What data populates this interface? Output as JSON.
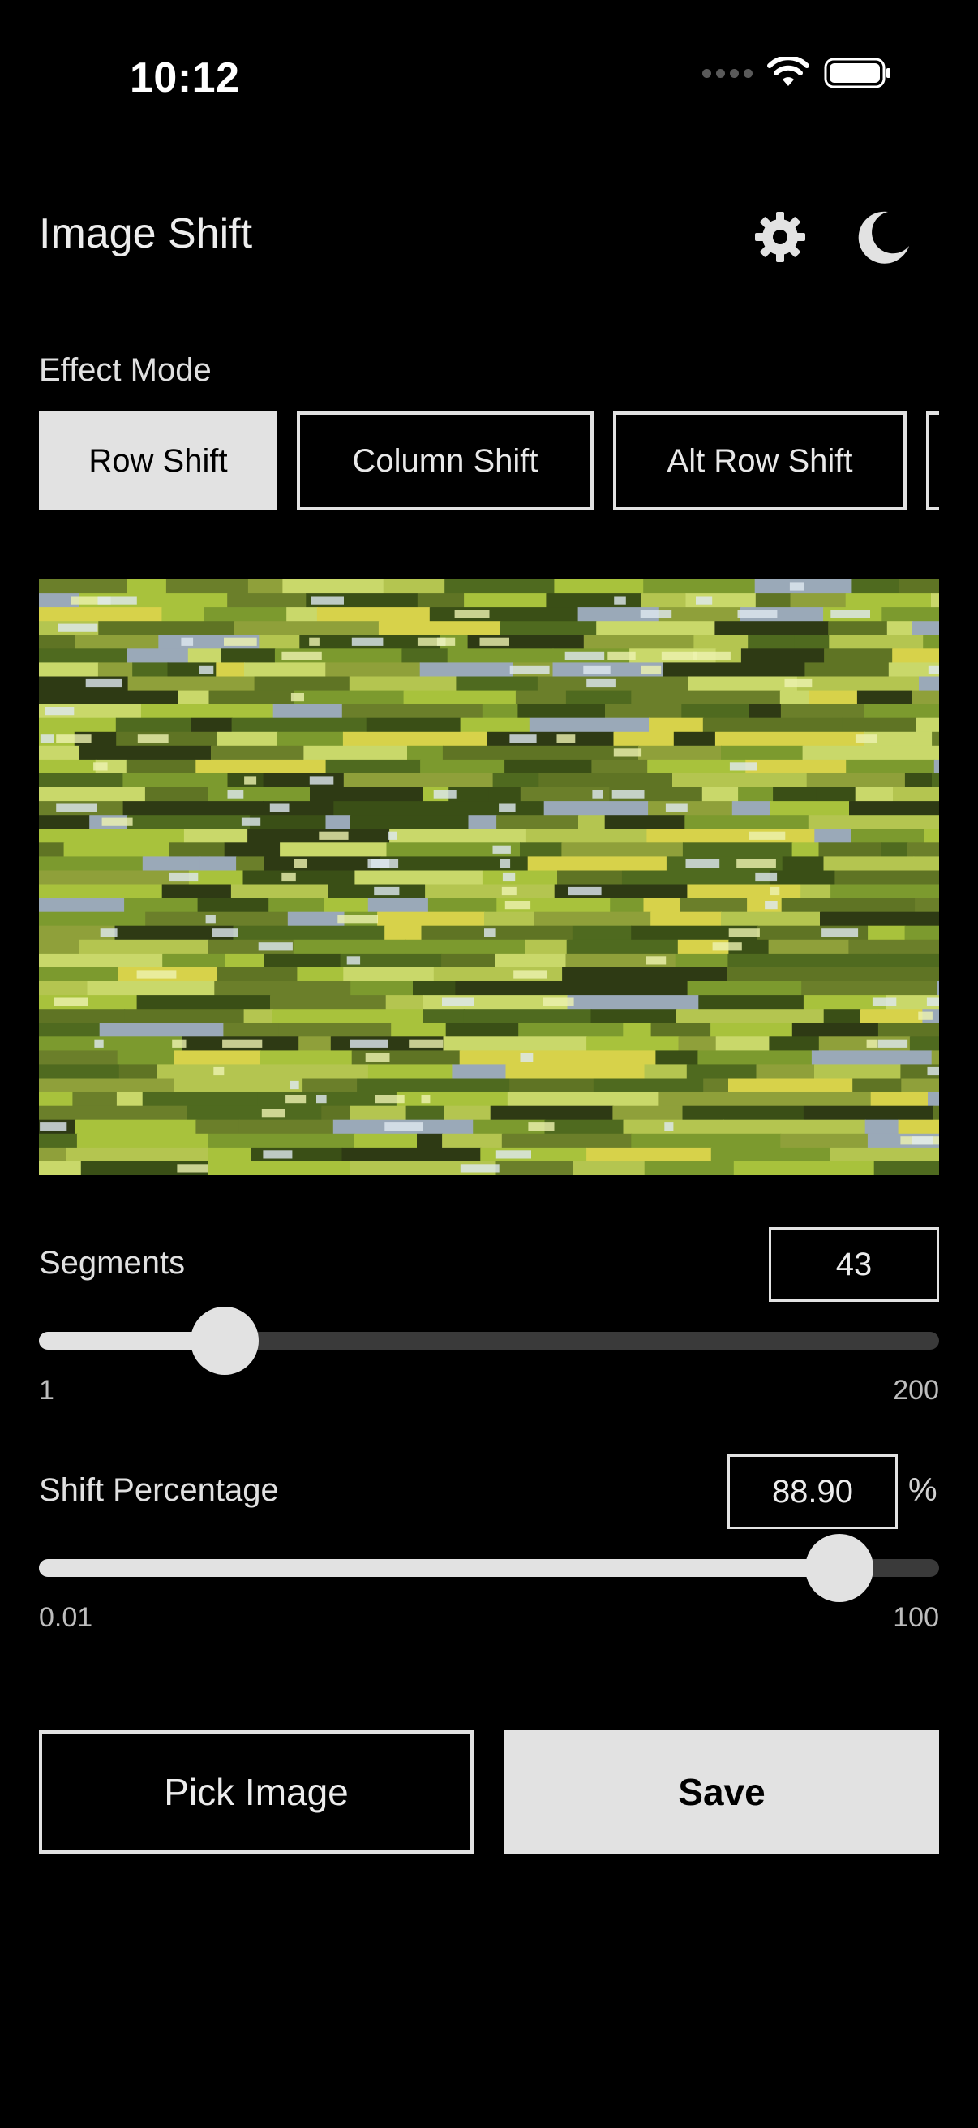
{
  "status_bar": {
    "time": "10:12"
  },
  "header": {
    "title": "Image Shift",
    "settings_icon": "gear-icon",
    "theme_icon": "moon-icon"
  },
  "effect_mode": {
    "label": "Effect Mode",
    "modes": [
      {
        "label": "Row Shift",
        "active": true
      },
      {
        "label": "Column Shift",
        "active": false
      },
      {
        "label": "Alt Row Shift",
        "active": false
      },
      {
        "label": "",
        "active": false
      }
    ]
  },
  "preview": {
    "description_icon": "shifted-image-preview"
  },
  "segments": {
    "label": "Segments",
    "value": "43",
    "min_label": "1",
    "max_label": "200",
    "level": 0.206
  },
  "shift_percentage": {
    "label": "Shift Percentage",
    "value": "88.90",
    "unit": "%",
    "min_label": "0.01",
    "max_label": "100",
    "level": 0.889
  },
  "actions": {
    "pick_label": "Pick Image",
    "save_label": "Save"
  },
  "colors": {
    "background": "#000000",
    "accent": "#e2e2e2",
    "track": "#3a3a3a"
  }
}
